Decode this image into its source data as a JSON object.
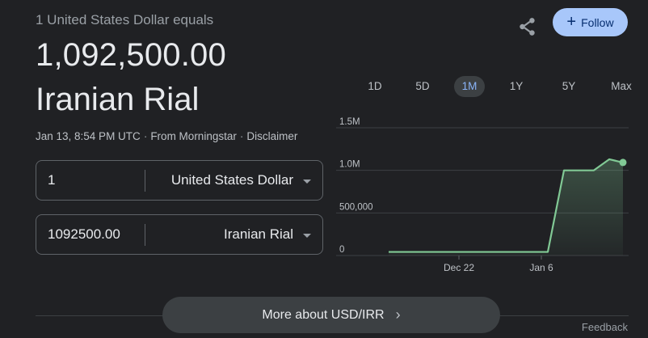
{
  "header": {
    "subtitle": "1 United States Dollar equals",
    "amount": "1,092,500.00",
    "currency": "Iranian Rial",
    "meta": {
      "timestamp": "Jan 13, 8:54 PM UTC",
      "source": "From Morningstar",
      "disclaimer": "Disclaimer",
      "separator": "·"
    }
  },
  "converter": {
    "from": {
      "value": "1",
      "currency": "United States Dollar"
    },
    "to": {
      "value": "1092500.00",
      "currency": "Iranian Rial"
    }
  },
  "actions": {
    "share_icon": "share-icon",
    "follow_label": "Follow",
    "follow_icon": "plus-icon"
  },
  "range_tabs": [
    "1D",
    "5D",
    "1M",
    "1Y",
    "5Y",
    "Max"
  ],
  "active_range": "1M",
  "colors": {
    "background": "#202124",
    "line": "#81c995",
    "active_tab_bg": "#3c4043",
    "active_tab_text": "#8ab4f8",
    "follow_bg": "#a8c7fa"
  },
  "chart_data": {
    "type": "area",
    "y_ticks": [
      "1.5M",
      "1.0M",
      "500,000",
      "0"
    ],
    "x_ticks": [
      "Dec 22",
      "Jan 6"
    ],
    "x": [
      "Dec 15",
      "Dec 17",
      "Dec 19",
      "Dec 21",
      "Dec 23",
      "Dec 25",
      "Dec 27",
      "Dec 29",
      "Dec 31",
      "Jan 2",
      "Jan 4",
      "Jan 5",
      "Jan 6",
      "Jan 8",
      "Jan 10",
      "Jan 12",
      "Jan 13"
    ],
    "series": [
      {
        "values": [
          42000,
          42000,
          42000,
          42000,
          42000,
          42000,
          42000,
          42000,
          42000,
          42000,
          42000,
          42000,
          1000000,
          1000000,
          1000000,
          1130000,
          1092500
        ]
      }
    ],
    "ylim": [
      0,
      1500000
    ],
    "grid": true
  },
  "more_button": {
    "label": "More about USD/IRR"
  },
  "feedback_label": "Feedback"
}
